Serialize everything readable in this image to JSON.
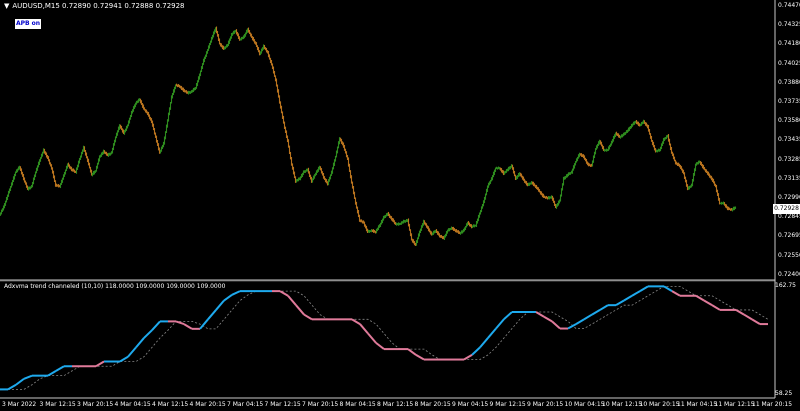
{
  "chart": {
    "symbol_line": "AUDUSD,M15  0.72890 0.72941 0.72888 0.72928",
    "badge": "APB on",
    "indicator_line": "Adxvma trend channeled (10,10) 118.0000 109.0000 109.0000 109.0000",
    "current_price": "0.72928",
    "colors": {
      "background": "#000000",
      "grid": "#222222",
      "candle_up": "#2e8b1e",
      "candle_down": "#b8731e",
      "trend_up": "#1eaaee",
      "trend_down": "#e07a9a",
      "dashed": "#888888"
    }
  },
  "price_axis": [
    "0.74470",
    "0.74325",
    "0.74180",
    "0.74025",
    "0.73880",
    "0.73735",
    "0.73580",
    "0.73435",
    "0.73285",
    "0.73135",
    "0.72990",
    "0.72845",
    "0.72695",
    "0.72550",
    "0.72400"
  ],
  "indicator_axis": [
    "162.75",
    "58.25"
  ],
  "time_axis": [
    "3 Mar 2022",
    "3 Mar 12:15",
    "3 Mar 20:15",
    "4 Mar 04:15",
    "4 Mar 12:15",
    "4 Mar 20:15",
    "7 Mar 04:15",
    "7 Mar 12:15",
    "7 Mar 20:15",
    "8 Mar 04:15",
    "8 Mar 12:15",
    "8 Mar 20:15",
    "9 Mar 04:15",
    "9 Mar 12:15",
    "9 Mar 20:15",
    "10 Mar 04:15",
    "10 Mar 12:15",
    "10 Mar 20:15",
    "11 Mar 04:15",
    "11 Mar 12:15",
    "11 Mar 20:15"
  ],
  "chart_data": {
    "type": "line",
    "price": {
      "x": [
        0,
        4,
        8,
        12,
        16,
        20,
        24,
        28,
        32,
        36,
        40,
        44,
        48,
        52,
        56,
        60,
        64,
        68,
        72,
        76,
        80,
        84,
        88,
        92,
        96,
        100,
        104,
        108,
        112,
        116,
        120,
        124,
        128,
        132,
        136,
        140,
        144,
        148,
        152,
        156,
        160,
        164,
        168,
        172,
        176,
        180,
        184,
        188,
        192,
        196,
        200,
        204,
        208,
        212,
        216,
        220,
        224,
        228,
        232,
        236,
        240,
        244,
        248,
        252,
        256,
        260,
        264,
        268,
        272,
        276,
        280,
        284,
        288,
        292,
        296,
        300,
        304,
        308,
        312,
        316,
        320,
        324,
        328,
        332,
        336,
        340,
        344,
        348,
        352,
        356,
        360,
        364,
        368,
        372,
        376,
        380,
        384,
        388,
        392,
        396,
        400,
        404,
        408,
        412,
        416,
        420,
        424,
        428,
        432,
        436,
        440,
        444,
        448,
        452,
        456,
        460,
        464,
        468,
        472,
        476,
        480,
        484,
        488,
        492,
        496,
        500,
        504,
        508,
        512,
        516,
        520,
        524,
        528,
        532,
        536,
        540,
        544,
        548,
        552,
        556,
        560,
        564,
        568,
        572,
        576,
        580,
        584,
        588,
        592,
        596,
        600,
        604,
        608,
        612,
        616,
        620,
        624,
        628,
        632,
        636,
        640,
        644,
        648,
        652,
        656,
        660,
        664,
        668,
        672,
        676,
        680,
        684,
        688,
        692,
        696,
        700,
        704,
        708,
        712,
        716,
        720,
        724,
        728,
        732,
        736,
        740,
        744,
        748,
        752,
        756,
        760,
        764
      ],
      "close": [
        0.7286,
        0.7292,
        0.7301,
        0.731,
        0.7319,
        0.7323,
        0.7314,
        0.7306,
        0.7308,
        0.7319,
        0.7328,
        0.7336,
        0.733,
        0.7322,
        0.7309,
        0.7308,
        0.7316,
        0.7325,
        0.7321,
        0.7319,
        0.7329,
        0.7338,
        0.7328,
        0.7317,
        0.732,
        0.7331,
        0.7335,
        0.7332,
        0.7334,
        0.7346,
        0.7355,
        0.7349,
        0.7355,
        0.7365,
        0.7372,
        0.7375,
        0.7368,
        0.7364,
        0.7358,
        0.7346,
        0.7334,
        0.7341,
        0.7359,
        0.7377,
        0.7386,
        0.7385,
        0.7382,
        0.738,
        0.7381,
        0.7384,
        0.7394,
        0.7405,
        0.7413,
        0.7422,
        0.743,
        0.7418,
        0.7414,
        0.7417,
        0.7425,
        0.7428,
        0.7421,
        0.7423,
        0.7429,
        0.7423,
        0.7418,
        0.741,
        0.7416,
        0.7411,
        0.7402,
        0.739,
        0.7373,
        0.7357,
        0.7343,
        0.7325,
        0.7312,
        0.7314,
        0.7319,
        0.7321,
        0.7312,
        0.7318,
        0.7323,
        0.7315,
        0.731,
        0.7319,
        0.7331,
        0.7345,
        0.7339,
        0.7329,
        0.7311,
        0.7295,
        0.7282,
        0.728,
        0.7273,
        0.7274,
        0.7273,
        0.7278,
        0.7284,
        0.7287,
        0.7283,
        0.7279,
        0.7279,
        0.7281,
        0.7282,
        0.7267,
        0.7263,
        0.7273,
        0.7281,
        0.7276,
        0.7271,
        0.7274,
        0.727,
        0.7268,
        0.7274,
        0.7276,
        0.7274,
        0.7272,
        0.7274,
        0.728,
        0.7277,
        0.7278,
        0.7287,
        0.7296,
        0.7308,
        0.7314,
        0.7322,
        0.7322,
        0.7318,
        0.7321,
        0.7324,
        0.7314,
        0.7318,
        0.7313,
        0.7309,
        0.7311,
        0.7308,
        0.7304,
        0.73,
        0.7299,
        0.73,
        0.7292,
        0.7297,
        0.7314,
        0.7317,
        0.7319,
        0.7327,
        0.7333,
        0.7331,
        0.7325,
        0.7324,
        0.7337,
        0.7343,
        0.7336,
        0.7336,
        0.7342,
        0.7349,
        0.7346,
        0.7348,
        0.7351,
        0.7355,
        0.7358,
        0.7355,
        0.7358,
        0.7354,
        0.7343,
        0.7335,
        0.7336,
        0.7344,
        0.7347,
        0.7334,
        0.7326,
        0.7324,
        0.7318,
        0.7306,
        0.7309,
        0.7325,
        0.7327,
        0.7322,
        0.7318,
        0.7314,
        0.7308,
        0.7295,
        0.7295,
        0.7291,
        0.729,
        0.7292
      ]
    },
    "indicator": {
      "x": [
        0,
        8,
        16,
        24,
        32,
        40,
        48,
        56,
        64,
        72,
        80,
        88,
        96,
        104,
        112,
        120,
        128,
        136,
        144,
        152,
        160,
        168,
        176,
        184,
        192,
        200,
        208,
        216,
        224,
        232,
        240,
        248,
        256,
        264,
        272,
        280,
        288,
        296,
        304,
        312,
        320,
        328,
        336,
        344,
        352,
        360,
        368,
        376,
        384,
        392,
        400,
        408,
        416,
        424,
        432,
        440,
        448,
        456,
        464,
        472,
        480,
        488,
        496,
        504,
        512,
        520,
        528,
        536,
        544,
        552,
        560,
        568,
        576,
        584,
        592,
        600,
        608,
        616,
        624,
        632,
        640,
        648,
        656,
        664,
        672,
        680,
        688,
        696,
        704,
        712,
        720,
        728,
        736,
        744,
        752,
        760,
        768
      ],
      "value": [
        62.7,
        62.7,
        67.2,
        73.0,
        76.0,
        76.0,
        76.0,
        80.6,
        85.1,
        85.1,
        85.1,
        85.1,
        85.1,
        89.7,
        89.7,
        89.7,
        94.3,
        103.4,
        112.5,
        120.0,
        128.5,
        128.5,
        128.5,
        125.9,
        121.3,
        121.3,
        130.5,
        139.6,
        148.7,
        154.2,
        157.8,
        157.8,
        157.8,
        157.8,
        157.8,
        157.8,
        153.3,
        144.2,
        135.1,
        130.5,
        130.5,
        130.5,
        130.5,
        130.5,
        130.5,
        125.9,
        116.8,
        107.7,
        101.7,
        101.7,
        101.7,
        101.7,
        96.1,
        91.6,
        91.6,
        91.6,
        91.6,
        91.6,
        91.6,
        96.1,
        103.4,
        112.5,
        121.6,
        130.7,
        137.6,
        137.6,
        137.6,
        137.6,
        133.0,
        128.5,
        121.6,
        121.6,
        125.9,
        130.5,
        135.1,
        139.6,
        144.2,
        144.2,
        148.7,
        153.3,
        157.8,
        162.4,
        162.4,
        162.4,
        157.8,
        153.3,
        153.3,
        153.3,
        148.7,
        144.2,
        139.6,
        139.6,
        139.6,
        135.1,
        130.5,
        125.9,
        125.9
      ],
      "trend": [
        "up",
        "up",
        "up",
        "up",
        "up",
        "up",
        "up",
        "up",
        "up",
        "down",
        "down",
        "down",
        "down",
        "up",
        "up",
        "up",
        "up",
        "up",
        "up",
        "up",
        "up",
        "down",
        "down",
        "down",
        "down",
        "up",
        "up",
        "up",
        "up",
        "up",
        "up",
        "up",
        "up",
        "up",
        "down",
        "down",
        "down",
        "down",
        "down",
        "down",
        "down",
        "down",
        "down",
        "down",
        "down",
        "down",
        "down",
        "down",
        "down",
        "down",
        "down",
        "down",
        "down",
        "down",
        "down",
        "down",
        "down",
        "down",
        "down",
        "up",
        "up",
        "up",
        "up",
        "up",
        "up",
        "up",
        "up",
        "down",
        "down",
        "down",
        "down",
        "up",
        "up",
        "up",
        "up",
        "up",
        "up",
        "up",
        "up",
        "up",
        "up",
        "up",
        "up",
        "up",
        "down",
        "down",
        "down",
        "down",
        "down",
        "down",
        "down",
        "down",
        "down",
        "down",
        "down",
        "down",
        "down"
      ]
    }
  }
}
